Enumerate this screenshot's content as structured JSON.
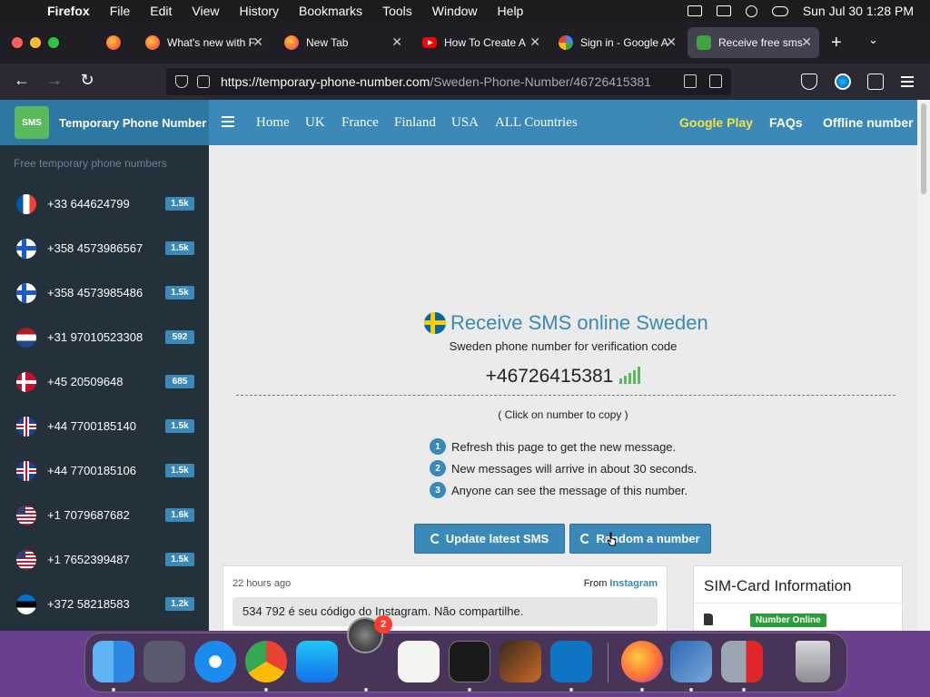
{
  "menubar": {
    "app_name": "Firefox",
    "items": [
      "File",
      "Edit",
      "View",
      "History",
      "Bookmarks",
      "Tools",
      "Window",
      "Help"
    ],
    "datetime": "Sun Jul 30  1:28 PM"
  },
  "browser": {
    "tabs": [
      {
        "title": "What's new with F",
        "favicon": "firefox-icon"
      },
      {
        "title": "New Tab",
        "favicon": "firefox-icon"
      },
      {
        "title": "How To Create A",
        "favicon": "youtube-icon"
      },
      {
        "title": "Sign in - Google A",
        "favicon": "google-icon"
      },
      {
        "title": "Receive free sms",
        "favicon": "sms-icon",
        "active": true
      }
    ],
    "url_host": "https://temporary-phone-number.com",
    "url_path": "/Sweden-Phone-Number/46726415381"
  },
  "site": {
    "brand": "Temporary Phone Number",
    "logo_text": "SMS",
    "nav": {
      "home": "Home",
      "uk": "UK",
      "france": "France",
      "finland": "Finland",
      "usa": "USA",
      "all": "ALL Countries",
      "google_play": "Google Play",
      "faqs": "FAQs",
      "offline": "Offline number"
    },
    "sidebar": {
      "caption": "Free temporary phone numbers",
      "items": [
        {
          "number": "+33 644624799",
          "count": "1.5k",
          "flag": "fr"
        },
        {
          "number": "+358 4573986567",
          "count": "1.5k",
          "flag": "fi"
        },
        {
          "number": "+358 4573985486",
          "count": "1.5k",
          "flag": "fi"
        },
        {
          "number": "+31 97010523308",
          "count": "592",
          "flag": "nl"
        },
        {
          "number": "+45 20509648",
          "count": "685",
          "flag": "dk"
        },
        {
          "number": "+44 7700185140",
          "count": "1.5k",
          "flag": "gb"
        },
        {
          "number": "+44 7700185106",
          "count": "1.5k",
          "flag": "gb"
        },
        {
          "number": "+1 7079687682",
          "count": "1.6k",
          "flag": "us"
        },
        {
          "number": "+1 7652399487",
          "count": "1.5k",
          "flag": "us"
        },
        {
          "number": "+372 58218583",
          "count": "1.2k",
          "flag": "ee"
        }
      ]
    },
    "main": {
      "title": "Receive SMS online Sweden",
      "subtitle": "Sweden phone number for verification code",
      "phone": "+46726415381",
      "copy_hint": "( Click on number to copy )",
      "steps": [
        {
          "n": "1",
          "text": "Refresh this page to get the new message."
        },
        {
          "n": "2",
          "text": "New messages will arrive in about 30 seconds."
        },
        {
          "n": "3",
          "text": "Anyone can see the message of this number."
        }
      ],
      "update_button": "Update latest SMS",
      "random_button": "Random a number",
      "message": {
        "time": "22 hours ago",
        "from_label": "From",
        "from_source": "Instagram",
        "text": "534 792 é seu código do Instagram. Não compartilhe."
      },
      "sim_card": {
        "title": "SIM-Card Information",
        "status": "Number Online"
      }
    }
  },
  "dock": {
    "notification_badge": "2",
    "apps": [
      "finder-icon",
      "launchpad-icon",
      "safari-icon",
      "chrome-icon",
      "app-store-icon",
      "system-preferences-icon",
      "textedit-icon",
      "terminal-icon",
      "garageband-icon",
      "vscode-icon",
      "firefox-icon",
      "virtualbox-icon",
      "parallels-icon",
      "trash-icon"
    ]
  }
}
